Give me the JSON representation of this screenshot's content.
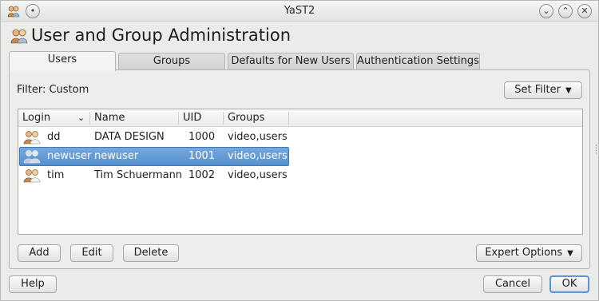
{
  "window": {
    "title": "YaST2"
  },
  "header": {
    "title": "User and Group Administration"
  },
  "tabs": [
    {
      "label": "Users"
    },
    {
      "label": "Groups"
    },
    {
      "label": "Defaults for New Users"
    },
    {
      "label": "Authentication Settings"
    }
  ],
  "filter": {
    "label": "Filter: Custom",
    "button": "Set Filter"
  },
  "table": {
    "columns": [
      "Login",
      "Name",
      "UID",
      "Groups"
    ],
    "rows": [
      {
        "login": "dd",
        "name": "DATA DESIGN",
        "uid": "1000",
        "groups": "video,users",
        "selected": false
      },
      {
        "login": "newuser",
        "name": "newuser",
        "uid": "1001",
        "groups": "video,users",
        "selected": true
      },
      {
        "login": "tim",
        "name": "Tim Schuermann",
        "uid": "1002",
        "groups": "video,users",
        "selected": false
      }
    ]
  },
  "actions": {
    "add": "Add",
    "edit": "Edit",
    "delete": "Delete",
    "expert": "Expert Options"
  },
  "footer": {
    "help": "Help",
    "cancel": "Cancel",
    "ok": "OK"
  },
  "colors": {
    "selection": "#5690cf",
    "ok_border": "#5b93d4"
  },
  "icons": {
    "window": "users-icon",
    "row": "user-pair-icon"
  }
}
